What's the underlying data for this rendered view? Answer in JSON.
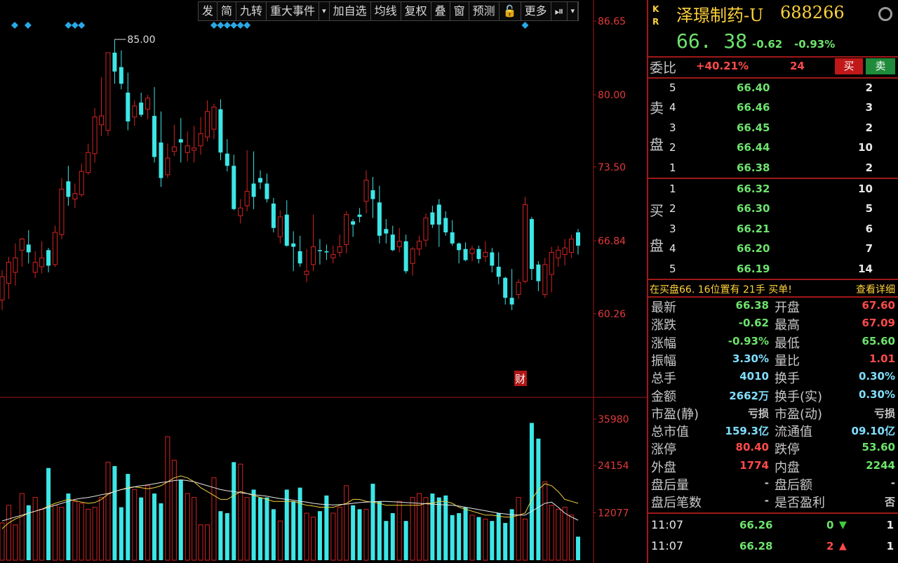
{
  "toolbar": {
    "items": [
      "发",
      "简",
      "九转",
      "重大事件",
      "▾",
      "加自选",
      "均线",
      "复权",
      "叠",
      "窗",
      "预测",
      "🔓",
      "更多",
      "⏯",
      "▾"
    ]
  },
  "colors": {
    "up": "#d42323",
    "down": "#3ce6e6",
    "ma_white": "#e6e6e6",
    "ma_yellow": "#f0d23c",
    "accent_red": "#a01818",
    "green": "#6de36d",
    "yellow": "#ffd23c",
    "cyan_marker": "#2aa8e6"
  },
  "chart_data": {
    "type": "candlestick",
    "price_axis_labels": [
      "86.65",
      "80.00",
      "73.50",
      "66.84",
      "60.26"
    ],
    "price_axis_values": [
      86.65,
      80.0,
      73.5,
      66.84,
      60.26
    ],
    "volume_axis_labels": [
      "35980",
      "24154",
      "12077"
    ],
    "volume_axis_values": [
      35980,
      24154,
      12077
    ],
    "high_annotation": "85.00",
    "event_badge": "财",
    "candles": [
      {
        "o": 61.5,
        "h": 64.2,
        "l": 60.6,
        "c": 63.6
      },
      {
        "o": 63.0,
        "h": 65.4,
        "l": 61.6,
        "c": 64.9
      },
      {
        "o": 64.0,
        "h": 66.6,
        "l": 62.8,
        "c": 65.3
      },
      {
        "o": 66.0,
        "h": 67.1,
        "l": 64.5,
        "c": 67.0
      },
      {
        "o": 66.5,
        "h": 67.8,
        "l": 64.8,
        "c": 65.8
      },
      {
        "o": 64.0,
        "h": 65.9,
        "l": 63.5,
        "c": 64.9
      },
      {
        "o": 64.5,
        "h": 66.8,
        "l": 63.9,
        "c": 65.3
      },
      {
        "o": 66.0,
        "h": 66.2,
        "l": 64.0,
        "c": 64.6
      },
      {
        "o": 64.7,
        "h": 68.2,
        "l": 64.5,
        "c": 67.6
      },
      {
        "o": 67.4,
        "h": 72.5,
        "l": 67.0,
        "c": 71.5
      },
      {
        "o": 72.2,
        "h": 73.6,
        "l": 70.0,
        "c": 70.8
      },
      {
        "o": 70.6,
        "h": 72.0,
        "l": 69.8,
        "c": 71.1
      },
      {
        "o": 71.0,
        "h": 73.8,
        "l": 70.8,
        "c": 73.1
      },
      {
        "o": 73.0,
        "h": 75.6,
        "l": 72.8,
        "c": 74.8
      },
      {
        "o": 74.7,
        "h": 78.8,
        "l": 73.9,
        "c": 78.0
      },
      {
        "o": 77.3,
        "h": 81.6,
        "l": 76.3,
        "c": 78.1
      },
      {
        "o": 76.8,
        "h": 82.5,
        "l": 76.3,
        "c": 83.8
      },
      {
        "o": 83.8,
        "h": 85.0,
        "l": 81.0,
        "c": 82.1
      },
      {
        "o": 82.5,
        "h": 84.0,
        "l": 80.5,
        "c": 81.0
      },
      {
        "o": 80.2,
        "h": 82.0,
        "l": 76.8,
        "c": 77.6
      },
      {
        "o": 78.0,
        "h": 79.5,
        "l": 77.2,
        "c": 79.0
      },
      {
        "o": 79.3,
        "h": 80.2,
        "l": 78.0,
        "c": 78.2
      },
      {
        "o": 78.7,
        "h": 80.0,
        "l": 77.8,
        "c": 79.7
      },
      {
        "o": 78.1,
        "h": 80.7,
        "l": 73.9,
        "c": 74.4
      },
      {
        "o": 75.7,
        "h": 78.5,
        "l": 71.7,
        "c": 72.5
      },
      {
        "o": 72.8,
        "h": 75.6,
        "l": 72.5,
        "c": 74.3
      },
      {
        "o": 74.9,
        "h": 77.3,
        "l": 74.5,
        "c": 75.3
      },
      {
        "o": 76.0,
        "h": 77.9,
        "l": 73.9,
        "c": 75.7
      },
      {
        "o": 74.8,
        "h": 76.7,
        "l": 74.0,
        "c": 75.4
      },
      {
        "o": 75.0,
        "h": 77.2,
        "l": 73.9,
        "c": 75.2
      },
      {
        "o": 75.4,
        "h": 78.0,
        "l": 74.6,
        "c": 76.5
      },
      {
        "o": 76.2,
        "h": 79.5,
        "l": 75.8,
        "c": 78.5
      },
      {
        "o": 76.9,
        "h": 79.2,
        "l": 76.0,
        "c": 78.9
      },
      {
        "o": 78.7,
        "h": 79.6,
        "l": 74.1,
        "c": 74.8
      },
      {
        "o": 74.7,
        "h": 76.0,
        "l": 73.1,
        "c": 73.6
      },
      {
        "o": 73.6,
        "h": 74.6,
        "l": 69.6,
        "c": 69.7
      },
      {
        "o": 69.1,
        "h": 70.6,
        "l": 68.4,
        "c": 69.8
      },
      {
        "o": 70.0,
        "h": 75.0,
        "l": 69.5,
        "c": 71.3
      },
      {
        "o": 72.0,
        "h": 74.9,
        "l": 69.7,
        "c": 70.8
      },
      {
        "o": 72.5,
        "h": 73.2,
        "l": 71.5,
        "c": 72.1
      },
      {
        "o": 72.0,
        "h": 72.9,
        "l": 70.3,
        "c": 70.6
      },
      {
        "o": 70.2,
        "h": 70.7,
        "l": 67.6,
        "c": 68.0
      },
      {
        "o": 67.2,
        "h": 69.6,
        "l": 66.6,
        "c": 69.0
      },
      {
        "o": 69.2,
        "h": 70.5,
        "l": 66.3,
        "c": 66.4
      },
      {
        "o": 66.6,
        "h": 67.7,
        "l": 64.1,
        "c": 66.3
      },
      {
        "o": 65.9,
        "h": 67.3,
        "l": 64.5,
        "c": 64.8
      },
      {
        "o": 63.8,
        "h": 66.1,
        "l": 63.1,
        "c": 64.1
      },
      {
        "o": 64.7,
        "h": 69.2,
        "l": 64.1,
        "c": 66.3
      },
      {
        "o": 66.0,
        "h": 67.0,
        "l": 64.7,
        "c": 65.9
      },
      {
        "o": 65.9,
        "h": 66.5,
        "l": 65.1,
        "c": 65.8
      },
      {
        "o": 65.3,
        "h": 66.4,
        "l": 64.8,
        "c": 65.6
      },
      {
        "o": 65.8,
        "h": 67.4,
        "l": 65.4,
        "c": 66.3
      },
      {
        "o": 66.5,
        "h": 69.5,
        "l": 65.7,
        "c": 69.2
      },
      {
        "o": 68.6,
        "h": 68.8,
        "l": 67.2,
        "c": 68.3
      },
      {
        "o": 69.2,
        "h": 69.8,
        "l": 68.5,
        "c": 69.0
      },
      {
        "o": 70.4,
        "h": 73.2,
        "l": 69.3,
        "c": 72.3
      },
      {
        "o": 71.4,
        "h": 72.6,
        "l": 68.9,
        "c": 70.6
      },
      {
        "o": 70.3,
        "h": 71.8,
        "l": 66.6,
        "c": 67.3
      },
      {
        "o": 67.9,
        "h": 68.8,
        "l": 66.6,
        "c": 67.5
      },
      {
        "o": 67.4,
        "h": 68.2,
        "l": 65.9,
        "c": 66.0
      },
      {
        "o": 66.3,
        "h": 68.0,
        "l": 65.8,
        "c": 66.8
      },
      {
        "o": 66.8,
        "h": 67.4,
        "l": 63.9,
        "c": 64.1
      },
      {
        "o": 64.8,
        "h": 66.3,
        "l": 63.7,
        "c": 66.1
      },
      {
        "o": 66.1,
        "h": 67.3,
        "l": 65.5,
        "c": 66.8
      },
      {
        "o": 66.9,
        "h": 69.3,
        "l": 66.3,
        "c": 68.9
      },
      {
        "o": 69.4,
        "h": 70.0,
        "l": 68.0,
        "c": 68.3
      },
      {
        "o": 70.1,
        "h": 70.6,
        "l": 66.3,
        "c": 68.3
      },
      {
        "o": 68.9,
        "h": 69.5,
        "l": 67.3,
        "c": 67.6
      },
      {
        "o": 67.6,
        "h": 68.7,
        "l": 66.4,
        "c": 66.6
      },
      {
        "o": 66.6,
        "h": 66.7,
        "l": 64.8,
        "c": 66.0
      },
      {
        "o": 66.1,
        "h": 66.7,
        "l": 65.0,
        "c": 65.1
      },
      {
        "o": 65.7,
        "h": 66.4,
        "l": 65.0,
        "c": 66.1
      },
      {
        "o": 66.1,
        "h": 66.4,
        "l": 64.8,
        "c": 65.2
      },
      {
        "o": 65.4,
        "h": 66.8,
        "l": 64.9,
        "c": 65.8
      },
      {
        "o": 65.8,
        "h": 66.2,
        "l": 64.0,
        "c": 64.6
      },
      {
        "o": 64.5,
        "h": 65.8,
        "l": 62.9,
        "c": 63.6
      },
      {
        "o": 63.5,
        "h": 63.6,
        "l": 61.1,
        "c": 61.7
      },
      {
        "o": 61.7,
        "h": 64.3,
        "l": 60.6,
        "c": 61.1
      },
      {
        "o": 62.0,
        "h": 63.4,
        "l": 61.6,
        "c": 63.1
      },
      {
        "o": 63.2,
        "h": 70.8,
        "l": 63.0,
        "c": 70.1
      },
      {
        "o": 68.8,
        "h": 69.0,
        "l": 63.3,
        "c": 64.3
      },
      {
        "o": 64.7,
        "h": 65.0,
        "l": 62.3,
        "c": 63.2
      },
      {
        "o": 62.0,
        "h": 65.3,
        "l": 61.7,
        "c": 64.7
      },
      {
        "o": 63.8,
        "h": 66.3,
        "l": 62.2,
        "c": 65.8
      },
      {
        "o": 65.3,
        "h": 66.4,
        "l": 64.5,
        "c": 66.0
      },
      {
        "o": 65.6,
        "h": 67.0,
        "l": 64.6,
        "c": 66.2
      },
      {
        "o": 65.8,
        "h": 67.4,
        "l": 65.3,
        "c": 67.0
      },
      {
        "o": 67.6,
        "h": 67.9,
        "l": 65.6,
        "c": 66.4
      }
    ],
    "volumes": [
      9500,
      14000,
      9000,
      17000,
      14000,
      16000,
      13000,
      23500,
      14000,
      13500,
      17000,
      15000,
      14500,
      13000,
      13500,
      16000,
      25000,
      24000,
      13500,
      22000,
      18000,
      16000,
      19000,
      17000,
      14500,
      31500,
      25500,
      20500,
      17000,
      16000,
      9000,
      9000,
      21000,
      12500,
      12000,
      25000,
      24500,
      16000,
      18000,
      16000,
      16000,
      13000,
      10000,
      18000,
      15000,
      18500,
      12000,
      11000,
      12500,
      16500,
      12000,
      13500,
      19000,
      14000,
      13000,
      13000,
      19500,
      15000,
      10000,
      12000,
      15000,
      10000,
      16000,
      17000,
      16000,
      17000,
      16000,
      16500,
      11500,
      12000,
      13500,
      11500,
      11000,
      10500,
      10000,
      12000,
      9500,
      13000,
      16000,
      10500,
      35000,
      31000,
      20000,
      14000,
      13000,
      13500,
      11500,
      6000
    ],
    "ma1": [
      8000,
      9500,
      10500,
      11200,
      12000,
      12500,
      13000,
      13800,
      14500,
      15000,
      15500,
      15200,
      14800,
      14500,
      14700,
      15500,
      16800,
      17500,
      18000,
      18500,
      18700,
      18500,
      18200,
      18500,
      19000,
      20000,
      21000,
      21500,
      21000,
      20000,
      18500,
      17500,
      16500,
      15500,
      15500,
      16500,
      17500,
      17000,
      16500,
      16000,
      15500,
      15000,
      15000,
      15000,
      15000,
      14500,
      14000,
      13800,
      13500,
      13500,
      13500,
      14000,
      14500,
      15500,
      15500,
      15000,
      14800,
      14500,
      14000,
      14000,
      14000,
      14000,
      14000,
      14000,
      14500,
      14500,
      15000,
      15000,
      14500,
      13500,
      13000,
      12500,
      12000,
      11500,
      11500,
      11200,
      11000,
      11000,
      11500,
      12000,
      15500,
      18000,
      19500,
      19000,
      17500,
      15500,
      15000,
      14500
    ],
    "ma2": [
      10000,
      10500,
      11000,
      11500,
      12000,
      12500,
      13000,
      13500,
      14000,
      14500,
      15000,
      15500,
      15800,
      16000,
      16300,
      16700,
      17000,
      17500,
      18000,
      18300,
      18700,
      19000,
      19200,
      19500,
      19800,
      20000,
      20300,
      20500,
      20300,
      20000,
      19500,
      19000,
      18500,
      18000,
      17700,
      17500,
      17200,
      17000,
      16700,
      16500,
      16300,
      16000,
      15700,
      15500,
      15300,
      15000,
      14800,
      14500,
      14300,
      14200,
      14100,
      14200,
      14300,
      14500,
      14700,
      14800,
      14900,
      15000,
      15000,
      14900,
      14800,
      14700,
      14600,
      14500,
      14400,
      14300,
      14200,
      14100,
      14000,
      13800,
      13500,
      13200,
      12900,
      12600,
      12300,
      12000,
      11800,
      11600,
      11500,
      11500,
      12500,
      13500,
      14500,
      14800,
      13500,
      12000,
      11000,
      10200
    ],
    "marker_rows": [
      {
        "group": "a",
        "count": 2
      },
      {
        "group": "b",
        "count": 3
      },
      {
        "group": "c",
        "count": 6
      },
      {
        "group": "d",
        "count": 1
      }
    ]
  },
  "quote": {
    "kr": [
      "K",
      "R"
    ],
    "name": "泽璟制药-U",
    "code": "688266",
    "last": "66. 38",
    "change": "-0.62",
    "change_pct": "-0.93%",
    "weibi_label": "委比",
    "weibi_value": "+40.21%",
    "weibi_diff": "24",
    "buy_label": "买",
    "sell_label": "卖",
    "sell_label_chars": [
      "卖",
      "盘"
    ],
    "buy_label_chars": [
      "买",
      "盘"
    ],
    "asks": [
      {
        "level": "5",
        "price": "66.40",
        "volume": "2"
      },
      {
        "level": "4",
        "price": "66.46",
        "volume": "3"
      },
      {
        "level": "3",
        "price": "66.45",
        "volume": "2"
      },
      {
        "level": "2",
        "price": "66.44",
        "volume": "10"
      },
      {
        "level": "1",
        "price": "66.38",
        "volume": "2"
      }
    ],
    "bids": [
      {
        "level": "1",
        "price": "66.32",
        "volume": "10"
      },
      {
        "level": "2",
        "price": "66.30",
        "volume": "5"
      },
      {
        "level": "3",
        "price": "66.21",
        "volume": "6"
      },
      {
        "level": "4",
        "price": "66.20",
        "volume": "7"
      },
      {
        "level": "5",
        "price": "66.19",
        "volume": "14"
      }
    ],
    "alert_text": "在买盘66. 16位置有 21手 买单!",
    "alert_link": "查看详细",
    "stats": [
      {
        "l1": "最新",
        "v1": "66.38",
        "c1": "#6de36d",
        "l2": "开盘",
        "v2": "67.60",
        "c2": "#ff4a4a"
      },
      {
        "l1": "涨跌",
        "v1": "-0.62",
        "c1": "#6de36d",
        "l2": "最高",
        "v2": "67.09",
        "c2": "#ff4a4a"
      },
      {
        "l1": "涨幅",
        "v1": "-0.93%",
        "c1": "#6de36d",
        "l2": "最低",
        "v2": "65.60",
        "c2": "#6de36d"
      },
      {
        "l1": "振幅",
        "v1": "3.30%",
        "c1": "#7fdfff",
        "l2": "量比",
        "v2": "1.01",
        "c2": "#ff4a4a"
      },
      {
        "l1": "总手",
        "v1": "4010",
        "c1": "#7fdfff",
        "l2": "换手",
        "v2": "0.30%",
        "c2": "#7fdfff"
      },
      {
        "l1": "金额",
        "v1": "2662万",
        "c1": "#7fdfff",
        "l2": "换手(实)",
        "v2": "0.30%",
        "c2": "#7fdfff"
      },
      {
        "l1": "市盈(静)",
        "v1": "亏损",
        "c1": "#c8c8c8",
        "l2": "市盈(动)",
        "v2": "亏损",
        "c2": "#c8c8c8"
      },
      {
        "l1": "总市值",
        "v1": "159.3亿",
        "c1": "#7fdfff",
        "l2": "流通值",
        "v2": "09.10亿",
        "c2": "#7fdfff"
      },
      {
        "l1": "涨停",
        "v1": "80.40",
        "c1": "#ff4a4a",
        "l2": "跌停",
        "v2": "53.60",
        "c2": "#6de36d"
      },
      {
        "l1": "外盘",
        "v1": "1774",
        "c1": "#ff4a4a",
        "l2": "内盘",
        "v2": "2244",
        "c2": "#6de36d"
      },
      {
        "l1": "盘后量",
        "v1": "-",
        "c1": "#c8c8c8",
        "l2": "盘后额",
        "v2": "-",
        "c2": "#c8c8c8"
      },
      {
        "l1": "盘后笔数",
        "v1": "-",
        "c1": "#c8c8c8",
        "l2": "是否盈利",
        "v2": "否",
        "c2": "#c8c8c8"
      }
    ],
    "ticks": [
      {
        "time": "11:07",
        "price": "66.26",
        "vol": "0",
        "dir": "down",
        "count": "1"
      },
      {
        "time": "11:07",
        "price": "66.28",
        "vol": "2",
        "dir": "up",
        "count": "1"
      }
    ]
  }
}
